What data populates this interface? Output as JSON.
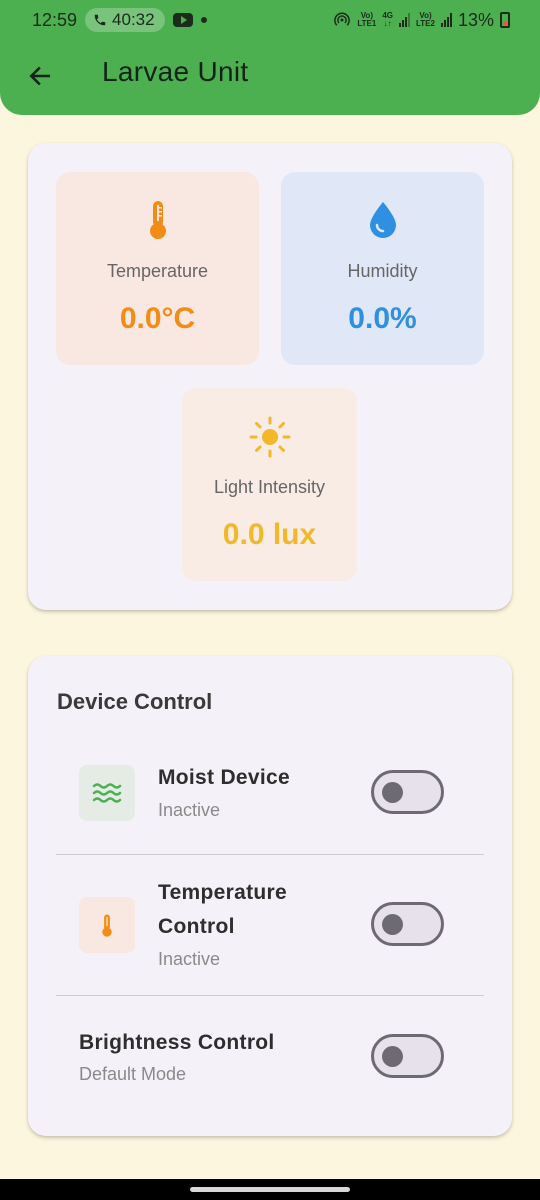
{
  "status_bar": {
    "time": "12:59",
    "call_timer": "40:32",
    "network_1_top": "Vo)",
    "network_1_bottom": "LTE1",
    "network_type": "4G",
    "network_2_top": "Vo)",
    "network_2_bottom": "LTE2",
    "battery": "13%"
  },
  "app_bar": {
    "title": "Larvae Unit",
    "color": "#4caf50"
  },
  "sensors": {
    "temperature": {
      "label": "Temperature",
      "value": "0.0°C",
      "icon": "thermometer-icon",
      "color": "#f28c14"
    },
    "humidity": {
      "label": "Humidity",
      "value": "0.0%",
      "icon": "water-drop-icon",
      "color": "#2f8fe0"
    },
    "light": {
      "label": "Light Intensity",
      "value": "0.0 lux",
      "icon": "sun-icon",
      "color": "#f2b82a"
    }
  },
  "device_control": {
    "title": "Device Control",
    "items": [
      {
        "title": "Moist Device",
        "status": "Inactive",
        "icon": "waves-icon",
        "enabled": false
      },
      {
        "title_line1": "Temperature",
        "title_line2": "Control",
        "status": "Inactive",
        "icon": "thermometer-icon",
        "enabled": false
      },
      {
        "title": "Brightness Control",
        "status": "Default Mode",
        "enabled": false
      }
    ]
  }
}
